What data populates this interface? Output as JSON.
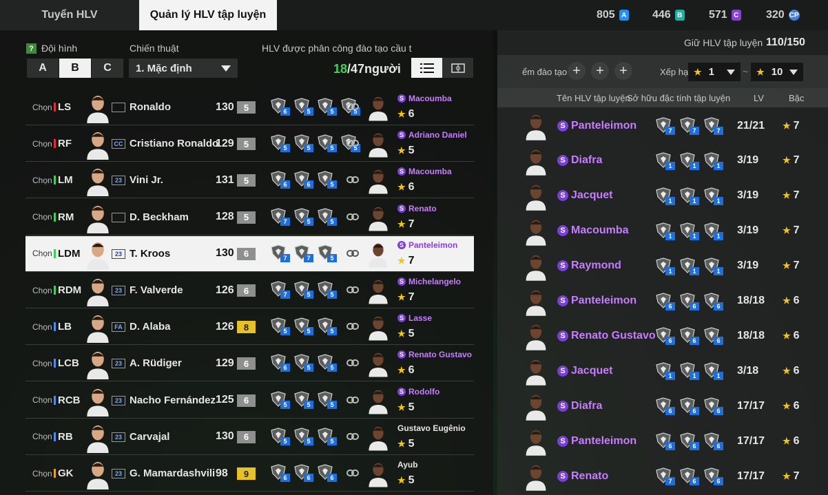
{
  "tabs": [
    {
      "label": "Tuyển HLV"
    },
    {
      "label": "Quản lý HLV tập luyện"
    }
  ],
  "currency": [
    {
      "value": "805",
      "code": "A",
      "color": "#1e90ff"
    },
    {
      "value": "446",
      "code": "B",
      "color": "#19b3a6"
    },
    {
      "value": "571",
      "code": "C",
      "color": "#8b3fd9"
    },
    {
      "value": "320",
      "code": "CP",
      "color": "#3f7fe0"
    }
  ],
  "left": {
    "help": "?",
    "squad_label": "Đội hình",
    "squads": [
      "A",
      "B",
      "C"
    ],
    "tactic_label": "Chiến thuật",
    "tactic_value": "1. Mặc định",
    "assigned_label": "HLV được phân công đào tạo cầu t",
    "assigned_count": "18",
    "assigned_total": "/47người",
    "select_label": "Chọn",
    "players": [
      {
        "pos": "LS",
        "posColor": "#e0302e",
        "badge": "",
        "name": "Ronaldo",
        "ovr": "130",
        "lvl": "5",
        "lvlColor": "#8e8f8f",
        "tr": [
          "6",
          "5",
          "5",
          "5"
        ],
        "coach": "Macoumba",
        "rank": "6",
        "s": true
      },
      {
        "pos": "RF",
        "posColor": "#e0302e",
        "badge": "CC",
        "name": "Cristiano Ronaldo",
        "ovr": "129",
        "lvl": "5",
        "lvlColor": "#8e8f8f",
        "tr": [
          "5",
          "5",
          "5",
          "5"
        ],
        "coach": "Adriano Daniel",
        "rank": "5",
        "s": true
      },
      {
        "pos": "LM",
        "posColor": "#3ccf5a",
        "badge": "23",
        "name": "Vini Jr.",
        "ovr": "131",
        "lvl": "5",
        "lvlColor": "#8e8f8f",
        "tr": [
          "6",
          "6",
          "5"
        ],
        "coach": "Macoumba",
        "rank": "6",
        "s": true
      },
      {
        "pos": "RM",
        "posColor": "#3ccf5a",
        "badge": "",
        "name": "D. Beckham",
        "ovr": "128",
        "lvl": "5",
        "lvlColor": "#8e8f8f",
        "tr": [
          "7",
          "5",
          "5"
        ],
        "coach": "Renato",
        "rank": "7",
        "s": true
      },
      {
        "pos": "LDM",
        "posColor": "#3ccf5a",
        "badge": "23",
        "name": "T. Kroos",
        "ovr": "130",
        "lvl": "6",
        "lvlColor": "#8e8f8f",
        "tr": [
          "7",
          "7",
          "5"
        ],
        "coach": "Panteleimon",
        "rank": "7",
        "s": true
      },
      {
        "pos": "RDM",
        "posColor": "#3ccf5a",
        "badge": "23",
        "name": "F. Valverde",
        "ovr": "126",
        "lvl": "6",
        "lvlColor": "#8e8f8f",
        "tr": [
          "7",
          "5",
          "5"
        ],
        "coach": "Michelangelo",
        "rank": "7",
        "s": true
      },
      {
        "pos": "LB",
        "posColor": "#4a8cf0",
        "badge": "FA",
        "name": "D. Alaba",
        "ovr": "126",
        "lvl": "8",
        "lvlColor": "#e6c12a",
        "tr": [
          "5",
          "5",
          "5"
        ],
        "coach": "Lasse",
        "rank": "5",
        "s": true
      },
      {
        "pos": "LCB",
        "posColor": "#4a8cf0",
        "badge": "23",
        "name": "A. Rüdiger",
        "ovr": "129",
        "lvl": "6",
        "lvlColor": "#8e8f8f",
        "tr": [
          "6",
          "5",
          "5"
        ],
        "coach": "Renato Gustavo",
        "rank": "6",
        "s": true
      },
      {
        "pos": "RCB",
        "posColor": "#4a8cf0",
        "badge": "23",
        "name": "Nacho Fernández",
        "ovr": "125",
        "lvl": "6",
        "lvlColor": "#8e8f8f",
        "tr": [
          "5",
          "5",
          "5"
        ],
        "coach": "Rodolfo",
        "rank": "5",
        "s": true
      },
      {
        "pos": "RB",
        "posColor": "#4a8cf0",
        "badge": "23",
        "name": "Carvajal",
        "ovr": "130",
        "lvl": "6",
        "lvlColor": "#8e8f8f",
        "tr": [
          "5",
          "5",
          "5"
        ],
        "coach": "Gustavo Eugênio",
        "rank": "5",
        "s": false
      },
      {
        "pos": "GK",
        "posColor": "#e6a21e",
        "badge": "23",
        "name": "G. Mamardashvili",
        "ovr": "98",
        "lvl": "9",
        "lvlColor": "#e6c12a",
        "tr": [
          "6",
          "6",
          "6"
        ],
        "coach": "Ayub",
        "rank": "5",
        "s": false
      }
    ]
  },
  "right": {
    "capacity_label": "Giữ HLV tập luyện",
    "capacity_value": "110/150",
    "filter_label": "ểm đào tạo",
    "sort_label": "Xếp hạ",
    "star_from": "1",
    "tilde": "~",
    "star_to": "10",
    "col_name": "Tên HLV tập luyện",
    "col_owned": "Sở hữu đặc tính tập luyện",
    "col_lv": "LV",
    "col_rank": "Bậc",
    "coaches": [
      {
        "name": "Panteleimon",
        "lv": "21/21",
        "rank": "7",
        "tr": [
          "7",
          "7",
          "7"
        ]
      },
      {
        "name": "Diafra",
        "lv": "3/19",
        "rank": "7",
        "tr": [
          "1",
          "1",
          "1"
        ]
      },
      {
        "name": "Jacquet",
        "lv": "3/19",
        "rank": "7",
        "tr": [
          "1",
          "1",
          "1"
        ]
      },
      {
        "name": "Macoumba",
        "lv": "3/19",
        "rank": "7",
        "tr": [
          "1",
          "1",
          "1"
        ]
      },
      {
        "name": "Raymond",
        "lv": "3/19",
        "rank": "7",
        "tr": [
          "1",
          "1",
          "1"
        ]
      },
      {
        "name": "Panteleimon",
        "lv": "18/18",
        "rank": "6",
        "tr": [
          "6",
          "6",
          "6"
        ]
      },
      {
        "name": "Renato Gustavo",
        "lv": "18/18",
        "rank": "6",
        "tr": [
          "6",
          "6",
          "6"
        ]
      },
      {
        "name": "Jacquet",
        "lv": "3/18",
        "rank": "6",
        "tr": [
          "1",
          "1",
          "1"
        ]
      },
      {
        "name": "Diafra",
        "lv": "17/17",
        "rank": "6",
        "tr": [
          "6",
          "6",
          "6"
        ]
      },
      {
        "name": "Panteleimon",
        "lv": "17/17",
        "rank": "6",
        "tr": [
          "6",
          "6",
          "6"
        ]
      },
      {
        "name": "Renato",
        "lv": "17/17",
        "rank": "7",
        "tr": [
          "7",
          "6",
          "6"
        ]
      }
    ]
  }
}
